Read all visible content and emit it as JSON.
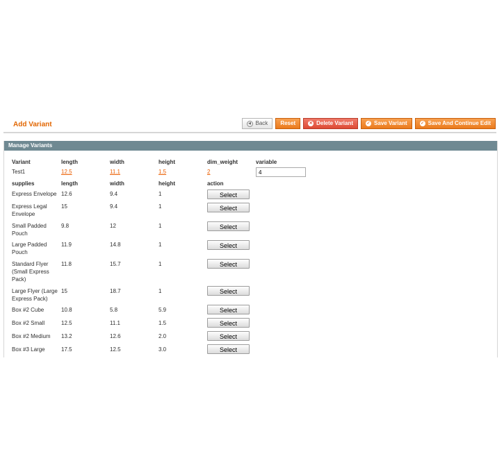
{
  "header": {
    "title": "Add Variant",
    "buttons": {
      "back": "Back",
      "reset": "Reset",
      "delete_variant": "Delete Variant",
      "save_variant": "Save Variant",
      "save_and_continue": "Save And Continue Edit"
    }
  },
  "panel": {
    "title": "Manage Variants",
    "variant_headers": [
      "Variant",
      "length",
      "width",
      "height",
      "dim_weight",
      "variable"
    ],
    "variant_row": {
      "name": "Test1",
      "length": "12.5",
      "width": "11.1",
      "height": "1.5",
      "dim_weight": "2",
      "variable": "4"
    },
    "supply_headers": [
      "supplies",
      "length",
      "width",
      "height",
      "action"
    ],
    "select_label": "Select",
    "supplies": [
      {
        "name": "Express Envelope",
        "length": "12.6",
        "width": "9.4",
        "height": "1"
      },
      {
        "name": "Express Legal Envelope",
        "length": "15",
        "width": "9.4",
        "height": "1"
      },
      {
        "name": "Small Padded Pouch",
        "length": "9.8",
        "width": "12",
        "height": "1"
      },
      {
        "name": "Large Padded Pouch",
        "length": "11.9",
        "width": "14.8",
        "height": "1"
      },
      {
        "name": "Standard Flyer (Small Express Pack)",
        "length": "11.8",
        "width": "15.7",
        "height": "1"
      },
      {
        "name": "Large Flyer (Large Express Pack)",
        "length": "15",
        "width": "18.7",
        "height": "1"
      },
      {
        "name": "Box #2 Cube",
        "length": "10.8",
        "width": "5.8",
        "height": "5.9"
      },
      {
        "name": "Box #2 Small",
        "length": "12.5",
        "width": "11.1",
        "height": "1.5"
      },
      {
        "name": "Box #2 Medium",
        "length": "13.2",
        "width": "12.6",
        "height": "2.0"
      },
      {
        "name": "Box #3 Large",
        "length": "17.5",
        "width": "12.5",
        "height": "3.0"
      }
    ]
  }
}
